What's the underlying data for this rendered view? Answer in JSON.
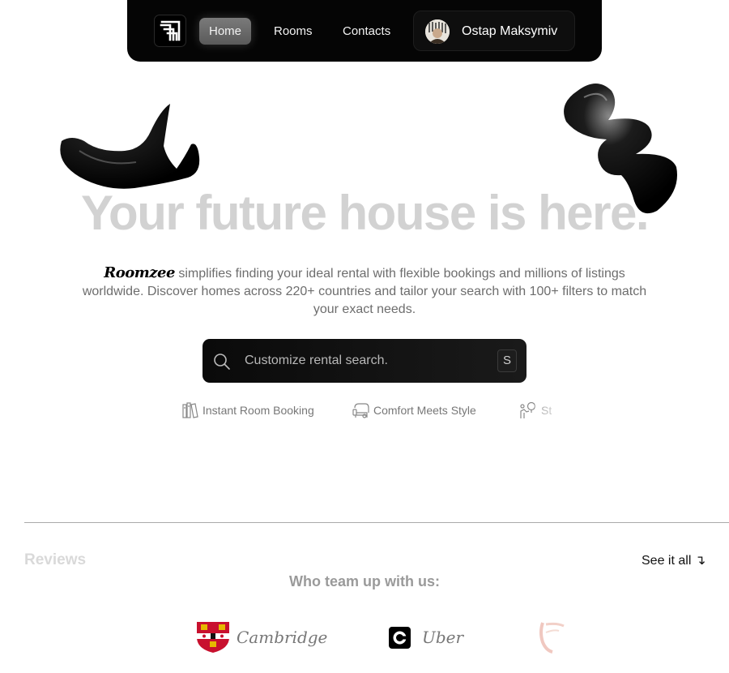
{
  "nav": {
    "logo_icon": "roomzee-logo-icon",
    "links": [
      {
        "label": "Home",
        "active": true
      },
      {
        "label": "Rooms",
        "active": false
      },
      {
        "label": "Contacts",
        "active": false
      }
    ],
    "user": {
      "name": "Ostap Maksymiv",
      "avatar_icon": "user-avatar"
    }
  },
  "hero": {
    "title": "Your future house is here.",
    "brand": "Roomzee",
    "description": " simplifies finding your ideal rental with flexible bookings and millions of listings worldwide. Discover homes across 220+ countries and tailor your search with 100+ filters to match your exact needs."
  },
  "search": {
    "placeholder": "Customize rental search.",
    "shortcut": "S",
    "icon": "search-icon"
  },
  "features": [
    {
      "label": "Instant Room Booking",
      "icon": "booking-icon"
    },
    {
      "label": "Comfort Meets Style",
      "icon": "sofa-icon"
    },
    {
      "label": "St",
      "icon": "location-person-icon"
    }
  ],
  "reviews": {
    "title": "Reviews",
    "see_all": "See it all ↴"
  },
  "partners": {
    "title": "Who team up with us:",
    "items": [
      {
        "name": "Cambridge",
        "icon": "cambridge-crest-icon"
      },
      {
        "name": "Uber",
        "icon": "uber-icon"
      },
      {
        "name": "",
        "icon": "partner-logo-faded"
      }
    ]
  },
  "colors": {
    "nav_bg": "#050505",
    "title_gray": "#d2d2d2",
    "text_gray": "#6d6d6d"
  }
}
